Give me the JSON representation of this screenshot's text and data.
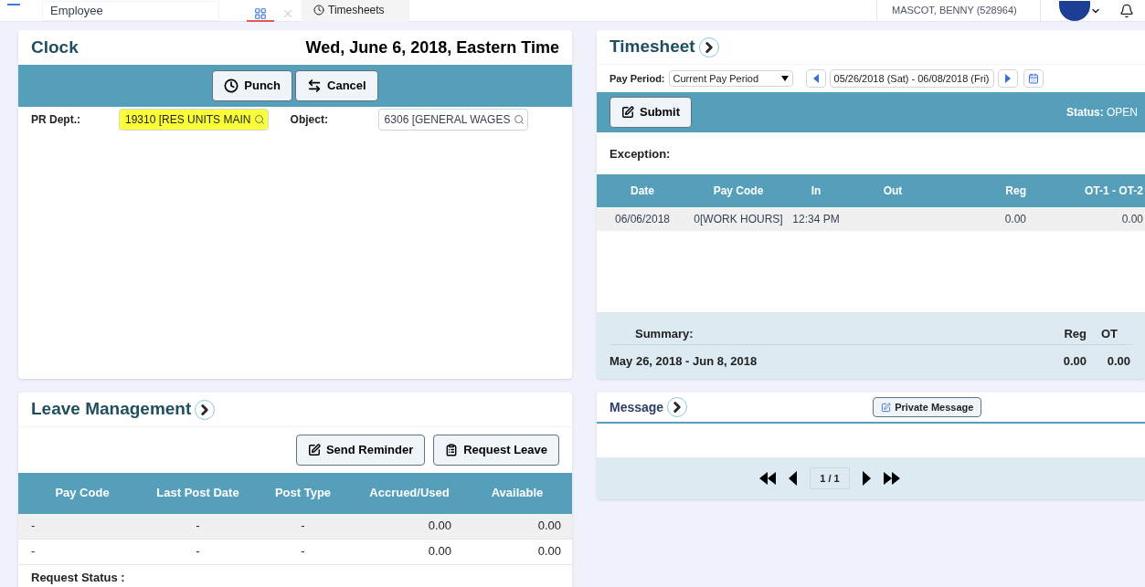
{
  "top_bar": {
    "search_value": "Employee",
    "tabs": [
      {
        "kind": "icon",
        "selected": true
      },
      {
        "kind": "close",
        "selected": false
      },
      {
        "kind": "text",
        "label": "Timesheets",
        "selected": false
      }
    ],
    "user_name": "MASCOT, BENNY (528964)"
  },
  "clock": {
    "title": "Clock",
    "date": "Wed, June 6, 2018, Eastern Time",
    "buttons": [
      "Punch",
      "Cancel"
    ],
    "fields": [
      {
        "label": "PR Dept.:",
        "value": "19310 [RES UNITS MAIN",
        "highlighted": true
      },
      {
        "label": "Object:",
        "value": "6306 [GENERAL WAGES",
        "highlighted": false
      }
    ]
  },
  "leave": {
    "title": "Leave Management",
    "buttons": [
      "Send Reminder",
      "Request Leave"
    ],
    "columns": [
      "Pay Code",
      "Last Post Date",
      "Post Type",
      "Accrued/Used",
      "Available"
    ],
    "rows": [
      [
        "-",
        "-",
        "-",
        "0.00",
        "0.00"
      ],
      [
        "-",
        "-",
        "-",
        "0.00",
        "0.00"
      ]
    ],
    "request_status_label": "Request Status :"
  },
  "timesheet": {
    "title": "Timesheet",
    "pay_period_label": "Pay Period:",
    "pay_period_value": "Current Pay Period",
    "date_range": "05/26/2018 (Sat) - 06/08/2018 (Fri)",
    "submit": "Submit",
    "status_label": "Status:",
    "status_value": "OPEN",
    "exception_label": "Exception:",
    "columns": [
      "Date",
      "Pay Code",
      "In",
      "Out",
      "Reg",
      "OT-1 - OT-2"
    ],
    "rows": [
      [
        "06/06/2018",
        "0[WORK HOURS]",
        "12:34 PM",
        "",
        "0.00",
        "0.00"
      ]
    ],
    "summary": {
      "label": "Summary:",
      "columns": [
        "Reg",
        "OT"
      ],
      "period": "May 26, 2018 - Jun 8, 2018",
      "values": [
        "0.00",
        "0.00"
      ]
    }
  },
  "message": {
    "title": "Message",
    "button": "Private Message",
    "page": "1 / 1"
  }
}
